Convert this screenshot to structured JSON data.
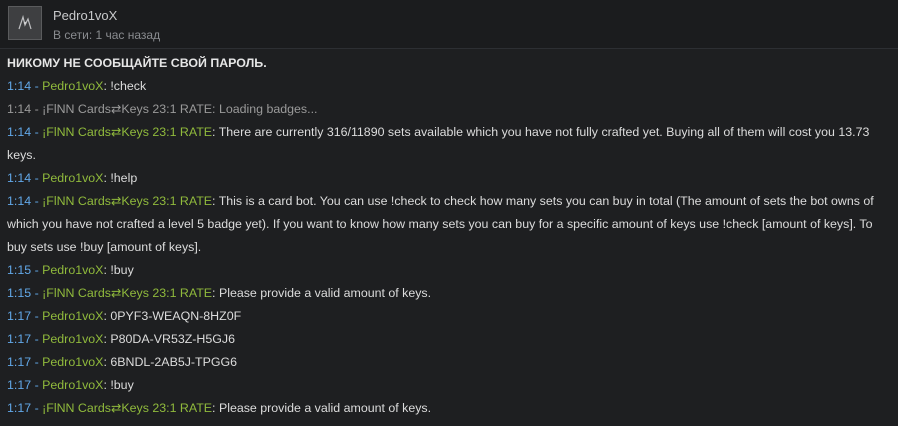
{
  "header": {
    "username": "Pedro1voX",
    "status": "В сети: 1 час назад"
  },
  "chat": {
    "warning": "НИКОМУ НЕ СООБЩАЙТЕ СВОЙ ПАРОЛЬ.",
    "separator": " - ",
    "colon": ": ",
    "messages": [
      {
        "time": "1:14",
        "sender": "Pedro1voX",
        "text": "!check",
        "style": "normal"
      },
      {
        "time": "1:14",
        "sender": "¡FlNN Cards⇄Keys 23:1 RATE",
        "text": "Loading badges...",
        "style": "dim"
      },
      {
        "time": "1:14",
        "sender": "¡FlNN Cards⇄Keys 23:1 RATE",
        "text": "There are currently 316/11890 sets available which you have not fully crafted yet. Buying all of them will cost you 13.73 keys.",
        "style": "normal"
      },
      {
        "time": "1:14",
        "sender": "Pedro1voX",
        "text": "!help",
        "style": "normal"
      },
      {
        "time": "1:14",
        "sender": "¡FlNN Cards⇄Keys 23:1 RATE",
        "text": "This is a card bot. You can use !check to check how many sets you can buy in total (The amount of sets the bot owns of which you have not crafted a level 5 badge yet). If you want to know how many sets you can buy for a specific amount of keys use !check [amount of keys]. To buy sets use !buy [amount of keys].",
        "style": "normal"
      },
      {
        "time": "1:15",
        "sender": "Pedro1voX",
        "text": "!buy",
        "style": "normal"
      },
      {
        "time": "1:15",
        "sender": "¡FlNN Cards⇄Keys 23:1 RATE",
        "text": "Please provide a valid amount of keys.",
        "style": "normal"
      },
      {
        "time": "1:17",
        "sender": "Pedro1voX",
        "text": "0PYF3-WEAQN-8HZ0F",
        "style": "normal"
      },
      {
        "time": "1:17",
        "sender": "Pedro1voX",
        "text": "P80DA-VR53Z-H5GJ6",
        "style": "normal"
      },
      {
        "time": "1:17",
        "sender": "Pedro1voX",
        "text": "6BNDL-2AB5J-TPGG6",
        "style": "normal"
      },
      {
        "time": "1:17",
        "sender": "Pedro1voX",
        "text": "!buy",
        "style": "normal"
      },
      {
        "time": "1:17",
        "sender": "¡FlNN Cards⇄Keys 23:1 RATE",
        "text": "Please provide a valid amount of keys.",
        "style": "normal"
      }
    ]
  },
  "colors": {
    "time": "#62a8e8",
    "sender": "#90ba3c",
    "dim": "#9a9a9a",
    "accent": "#1a9fff"
  }
}
